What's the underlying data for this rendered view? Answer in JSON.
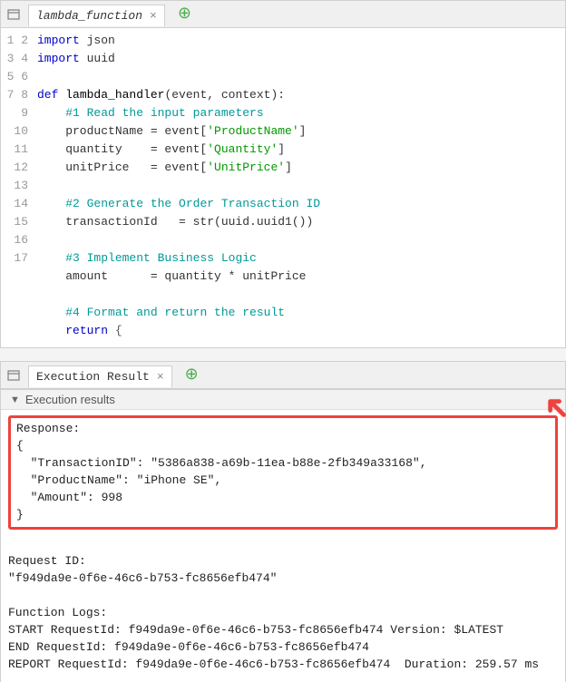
{
  "editor": {
    "tab_label": "lambda_function",
    "lines": [
      "import json",
      "import uuid",
      "",
      "def lambda_handler(event, context):",
      "    #1 Read the input parameters",
      "    productName = event['ProductName']",
      "    quantity    = event['Quantity']",
      "    unitPrice   = event['UnitPrice']",
      "",
      "    #2 Generate the Order Transaction ID",
      "    transactionId   = str(uuid.uuid1())",
      "",
      "    #3 Implement Business Logic",
      "    amount      = quantity * unitPrice",
      "",
      "    #4 Format and return the result",
      "    return {"
    ]
  },
  "results": {
    "tab_label": "Execution Result",
    "header": "Execution results",
    "response_label": "Response:",
    "response_json": {
      "TransactionID": "5386a838-a69b-11ea-b88e-2fb349a33168",
      "ProductName": "iPhone SE",
      "Amount": 998
    },
    "request_id_label": "Request ID:",
    "request_id": "f949da9e-0f6e-46c6-b753-fc8656efb474",
    "logs_label": "Function Logs:",
    "logs": [
      "START RequestId: f949da9e-0f6e-46c6-b753-fc8656efb474 Version: $LATEST",
      "END RequestId: f949da9e-0f6e-46c6-b753-fc8656efb474",
      "REPORT RequestId: f949da9e-0f6e-46c6-b753-fc8656efb474  Duration: 259.57 ms"
    ]
  }
}
